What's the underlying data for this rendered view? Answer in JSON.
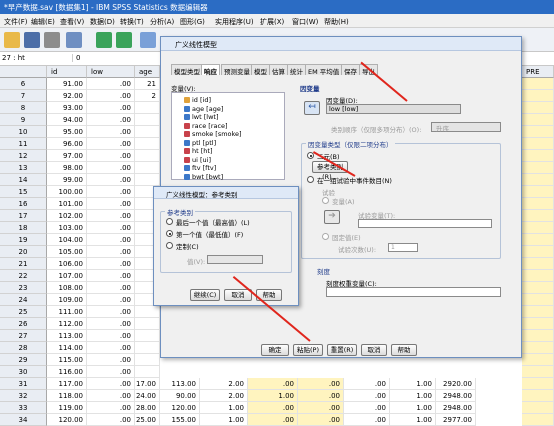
{
  "window": {
    "title": "*早产数据.sav [数据集1] - IBM SPSS Statistics 数据编辑器"
  },
  "menu": [
    "文件(F)",
    "编辑(E)",
    "查看(V)",
    "数据(D)",
    "转换(T)",
    "分析(A)",
    "图形(G)",
    "实用程序(U)",
    "扩展(X)",
    "窗口(W)",
    "帮助(H)"
  ],
  "cellbar": {
    "ref": "27 : ht",
    "value": "0"
  },
  "grid": {
    "cols": [
      "id",
      "low",
      "age",
      "PRE"
    ],
    "rows": [
      [
        "6",
        "91.00",
        ".00",
        "21"
      ],
      [
        "7",
        "92.00",
        ".00",
        "2"
      ],
      [
        "8",
        "93.00",
        ".00",
        ""
      ],
      [
        "9",
        "94.00",
        ".00",
        ""
      ],
      [
        "10",
        "95.00",
        ".00",
        ""
      ],
      [
        "11",
        "96.00",
        ".00",
        ""
      ],
      [
        "12",
        "97.00",
        ".00",
        ""
      ],
      [
        "13",
        "98.00",
        ".00",
        ""
      ],
      [
        "14",
        "99.00",
        ".00",
        ""
      ],
      [
        "15",
        "100.00",
        ".00",
        ""
      ],
      [
        "16",
        "101.00",
        ".00",
        ""
      ],
      [
        "17",
        "102.00",
        ".00",
        ""
      ],
      [
        "18",
        "103.00",
        ".00",
        ""
      ],
      [
        "19",
        "104.00",
        ".00",
        ""
      ],
      [
        "20",
        "105.00",
        ".00",
        ""
      ],
      [
        "21",
        "106.00",
        ".00",
        ""
      ],
      [
        "22",
        "107.00",
        ".00",
        ""
      ],
      [
        "23",
        "108.00",
        ".00",
        ""
      ],
      [
        "24",
        "109.00",
        ".00",
        ""
      ],
      [
        "25",
        "111.00",
        ".00",
        ""
      ],
      [
        "26",
        "112.00",
        ".00",
        ""
      ],
      [
        "27",
        "113.00",
        ".00",
        ""
      ],
      [
        "28",
        "114.00",
        ".00",
        ""
      ],
      [
        "29",
        "115.00",
        ".00",
        ""
      ],
      [
        "30",
        "116.00",
        ".00",
        ""
      ],
      [
        "31",
        "117.00",
        ".00",
        "17.00"
      ],
      [
        "32",
        "118.00",
        ".00",
        "24.00"
      ],
      [
        "33",
        "119.00",
        ".00",
        "28.00"
      ],
      [
        "34",
        "120.00",
        ".00",
        "25.00"
      ]
    ],
    "tail": [
      [
        "113.00",
        "2.00",
        ".00",
        ".00",
        ".00",
        "1.00",
        "2920.00"
      ],
      [
        "90.00",
        "2.00",
        "1.00",
        ".00",
        ".00",
        "1.00",
        "2948.00"
      ],
      [
        "120.00",
        "1.00",
        ".00",
        ".00",
        ".00",
        "1.00",
        "2948.00"
      ],
      [
        "155.00",
        "1.00",
        ".00",
        ".00",
        ".00",
        "1.00",
        "2977.00"
      ]
    ]
  },
  "dialog": {
    "title": "广义线性模型",
    "tabs": [
      "模型类型",
      "响应",
      "预测变量",
      "模型",
      "估算",
      "统计",
      "EM 平均值",
      "保存",
      "导出"
    ],
    "vars_label": "变量(V):",
    "vars": [
      "id [id]",
      "age [age]",
      "lwt [lwt]",
      "race [race]",
      "smoke [smoke]",
      "ptl [ptl]",
      "ht [ht]",
      "ui [ui]",
      "ftv [ftv]",
      "bwt [bwt]"
    ],
    "dep_label": "因变量",
    "dep_field_label": "因变量(D):",
    "dep_value": "low [low]",
    "cat_order_label": "类别顺序（仅限多项分布）(O):",
    "cat_order_value": "升序",
    "dep_type_group": "因变量类型（仅限二项分布）",
    "binary": "二元(B)",
    "ref_cat_btn": "参考类别(R)...",
    "events_trials": "在一组试验中事件数目(N)",
    "trials_label": "试验",
    "variable_radio": "变量(A)",
    "trial_var_label": "试验变量(T):",
    "fixed_radio": "固定值(E)",
    "trial_count_label": "试验次数(U):",
    "trial_count_value": "1",
    "scale_weight_group": "刻度",
    "scale_weight_label": "刻度权重变量(C):",
    "buttons": [
      "确定",
      "粘贴(P)",
      "重置(R)",
      "取消",
      "帮助"
    ]
  },
  "subdialog": {
    "title": "广义线性模型：参考类别",
    "group": "参考类别",
    "options": [
      "最后一个值（最高值）(L)",
      "第一个值（最低值）(F)",
      "定制(C)"
    ],
    "value_label": "值(V):",
    "buttons": [
      "继续(C)",
      "取消",
      "帮助"
    ]
  }
}
